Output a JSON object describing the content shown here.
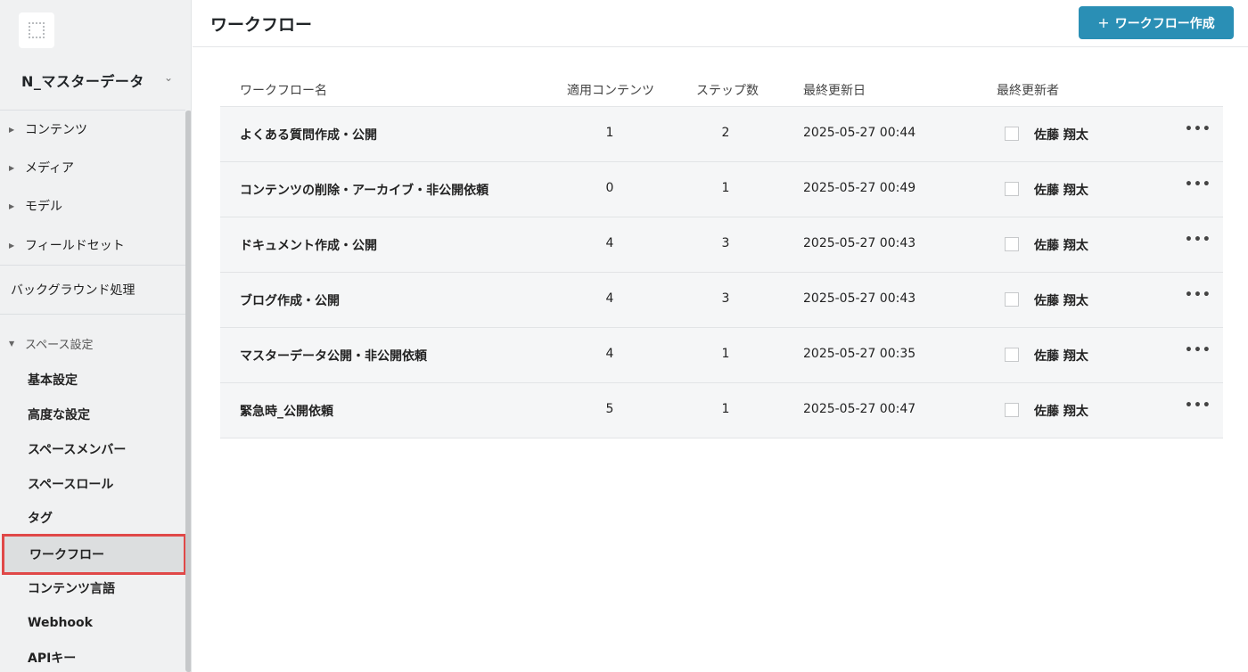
{
  "sidebar": {
    "space_name": "N_マスターデータ",
    "nav": [
      {
        "label": "コンテンツ"
      },
      {
        "label": "メディア"
      },
      {
        "label": "モデル"
      },
      {
        "label": "フィールドセット"
      }
    ],
    "background_label": "バックグラウンド処理",
    "settings_section": "スペース設定",
    "settings_items": [
      {
        "label": "基本設定"
      },
      {
        "label": "高度な設定"
      },
      {
        "label": "スペースメンバー"
      },
      {
        "label": "スペースロール"
      },
      {
        "label": "タグ"
      },
      {
        "label": "ワークフロー"
      },
      {
        "label": "コンテンツ言語"
      },
      {
        "label": "Webhook"
      },
      {
        "label": "APIキー"
      }
    ]
  },
  "header": {
    "title": "ワークフロー",
    "create_button": "ワークフロー作成"
  },
  "table": {
    "columns": [
      "ワークフロー名",
      "適用コンテンツ",
      "ステップ数",
      "最終更新日",
      "最終更新者"
    ],
    "rows": [
      {
        "name": "よくある質問作成・公開",
        "contents": "1",
        "steps": "2",
        "updated": "2025-05-27 00:44",
        "user": "佐藤 翔太"
      },
      {
        "name": "コンテンツの削除・アーカイブ・非公開依頼",
        "contents": "0",
        "steps": "1",
        "updated": "2025-05-27 00:49",
        "user": "佐藤 翔太"
      },
      {
        "name": "ドキュメント作成・公開",
        "contents": "4",
        "steps": "3",
        "updated": "2025-05-27 00:43",
        "user": "佐藤 翔太"
      },
      {
        "name": "ブログ作成・公開",
        "contents": "4",
        "steps": "3",
        "updated": "2025-05-27 00:43",
        "user": "佐藤 翔太"
      },
      {
        "name": "マスターデータ公開・非公開依頼",
        "contents": "4",
        "steps": "1",
        "updated": "2025-05-27 00:35",
        "user": "佐藤 翔太"
      },
      {
        "name": "緊急時_公開依頼",
        "contents": "5",
        "steps": "1",
        "updated": "2025-05-27 00:47",
        "user": "佐藤 翔太"
      }
    ]
  },
  "colors": {
    "accent": "#2a8fb5",
    "highlight": "#e04848"
  }
}
